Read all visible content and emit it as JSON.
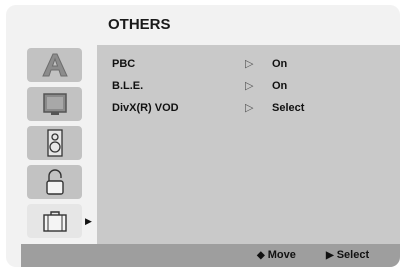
{
  "menu": {
    "title": "OTHERS"
  },
  "sidebar": {
    "items": [
      {
        "icon": "letter-a-icon"
      },
      {
        "icon": "tv-icon"
      },
      {
        "icon": "speaker-icon"
      },
      {
        "icon": "lock-icon"
      },
      {
        "icon": "briefcase-icon",
        "selected": true,
        "pointer": "▶"
      }
    ]
  },
  "settings": [
    {
      "label": "PBC",
      "marker": "▷",
      "value": "On"
    },
    {
      "label": "B.L.E.",
      "marker": "▷",
      "value": "On"
    },
    {
      "label": "DivX(R) VOD",
      "marker": "▷",
      "value": "Select"
    }
  ],
  "footer": {
    "move_icon": "◆",
    "move_label": "Move",
    "select_icon": "▶",
    "select_label": "Select"
  },
  "colors": {
    "panel": "#c9c9c9",
    "footer": "#9e9e9e",
    "tile": "#c2c2c2",
    "tile_active": "#e6e6e6"
  }
}
